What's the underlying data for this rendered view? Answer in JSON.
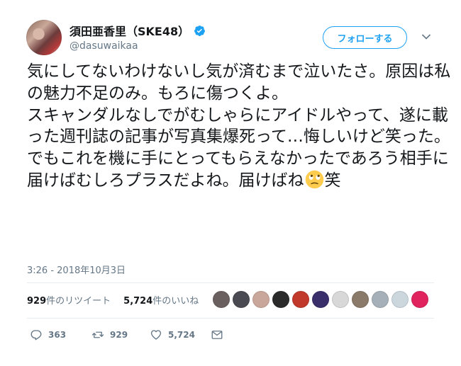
{
  "header": {
    "display_name": "須田亜香里（SKE48）",
    "handle": "@dasuwaikaa",
    "follow_label": "フォローする"
  },
  "tweet": {
    "text": "気にしてないわけないし気が済むまで泣いたさ。原因は私の魅力不足のみ。もろに傷つくよ。\nスキャンダルなしでがむしゃらにアイドルやって、遂に載った週刊誌の記事が写真集爆死って…悔しいけど笑った。でもこれを機に手にとってもらえなかったであろう相手に届けばむしろプラスだよね。届けばね",
    "text_tail": "笑",
    "emoji": "face-with-rolling-eyes-emoji",
    "timestamp": "3:26 - 2018年10月3日"
  },
  "stats": {
    "retweet_count": "929",
    "retweet_label": "件のリツイート",
    "like_count": "5,724",
    "like_label": "件のいいね"
  },
  "likers": [
    {
      "icon": "liker-avatar",
      "color": "#6b6060"
    },
    {
      "icon": "liker-avatar",
      "color": "#4a4a52"
    },
    {
      "icon": "liker-avatar",
      "color": "#c9a79a"
    },
    {
      "icon": "liker-avatar",
      "color": "#2a2a2a"
    },
    {
      "icon": "liker-avatar",
      "color": "#c0392b"
    },
    {
      "icon": "liker-avatar",
      "color": "#3a2f6b"
    },
    {
      "icon": "liker-avatar",
      "color": "#d8d8d8"
    },
    {
      "icon": "liker-avatar",
      "color": "#8a7a6a"
    },
    {
      "icon": "liker-avatar",
      "color": "#a6b0b8"
    },
    {
      "icon": "liker-avatar",
      "color": "#ccd6dd"
    },
    {
      "icon": "liker-avatar",
      "color": "#e0245e"
    }
  ],
  "actions": {
    "reply_count": "363",
    "retweet_count": "929",
    "like_count": "5,724"
  },
  "colors": {
    "accent": "#1da1f2",
    "text": "#14171a",
    "muted": "#657786",
    "divider": "#e6ecf0"
  }
}
